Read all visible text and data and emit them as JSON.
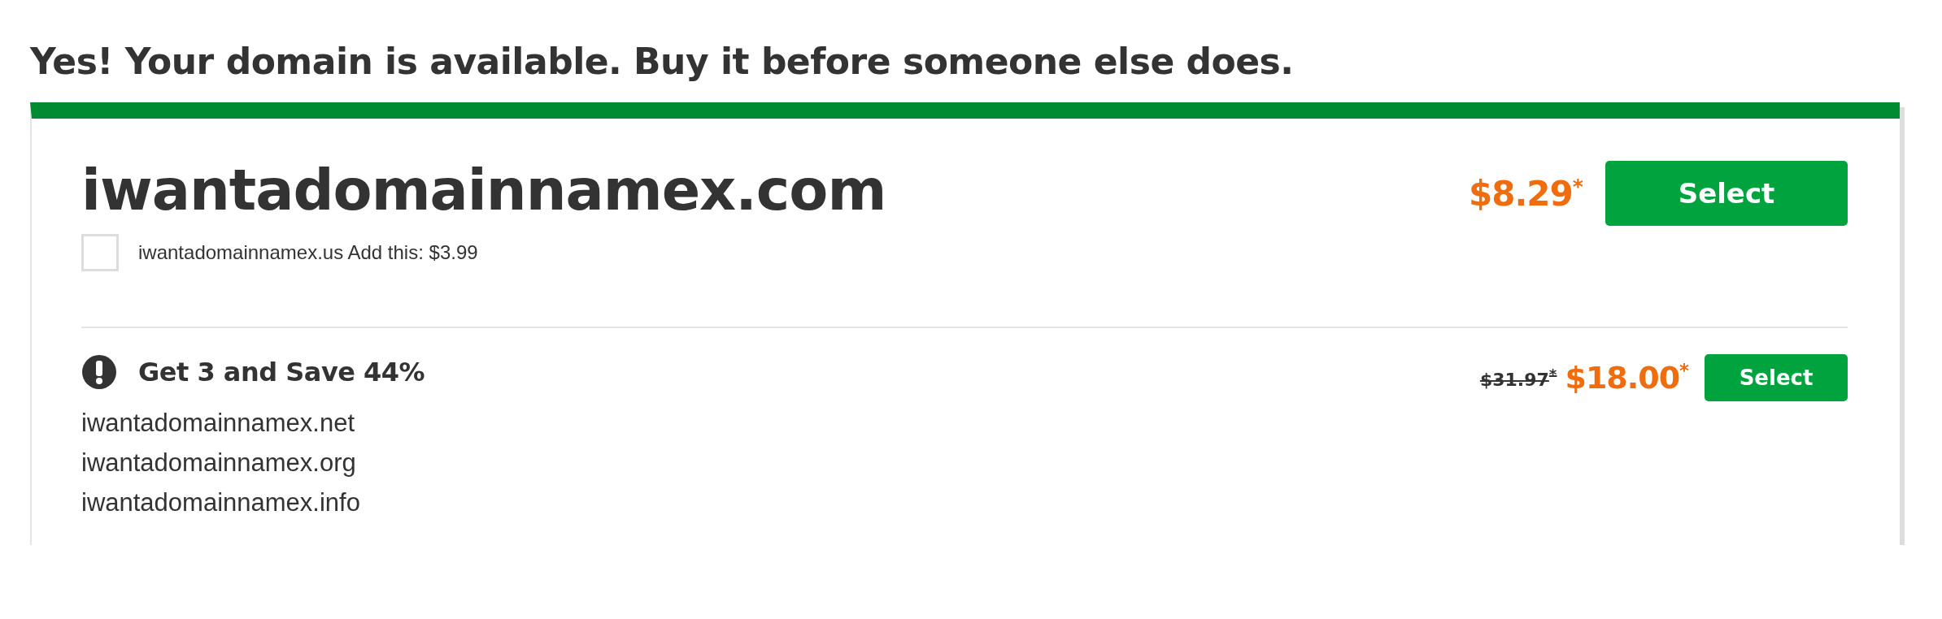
{
  "headline": "Yes! Your domain is available. Buy it before someone else does.",
  "main_offer": {
    "domain": "iwantadomainnamex.com",
    "price": "$8.29$^{*}$",
    "button": "Select",
    "addon": {
      "checked": false,
      "label": "iwantadomainnamex.us Add this: $3.99"
    }
  },
  "bundle": {
    "title": "Get 3 and Save 44%",
    "old_price": "$31.97$^{*}$",
    "price": "$18.00$^{*}$",
    "button": "Select",
    "domains": [
      "iwantadomainnamex.net",
      "iwantadomainnamex.org",
      "iwantadomainnamex.info"
    ]
  }
}
